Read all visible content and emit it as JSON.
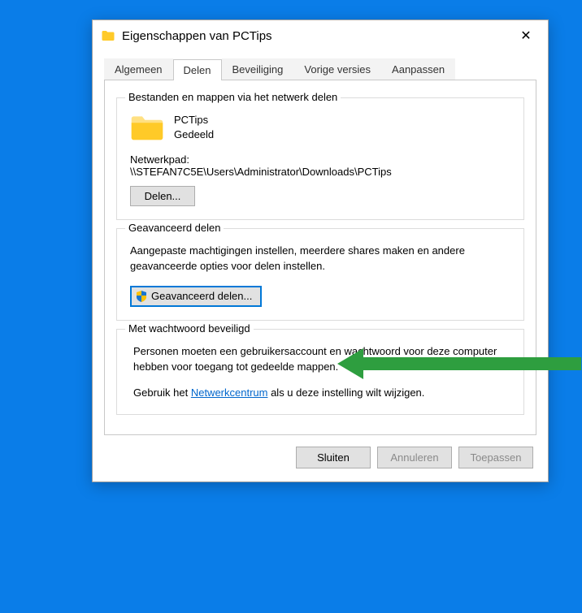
{
  "window": {
    "title": "Eigenschappen van PCTips"
  },
  "tabs": {
    "algemeen": "Algemeen",
    "delen": "Delen",
    "beveiliging": "Beveiliging",
    "vorige_versies": "Vorige versies",
    "aanpassen": "Aanpassen"
  },
  "share_group": {
    "legend": "Bestanden en mappen via het netwerk delen",
    "folder_name": "PCTips",
    "status": "Gedeeld",
    "netpath_label": "Netwerkpad:",
    "netpath_value": "\\\\STEFAN7C5E\\Users\\Administrator\\Downloads\\PCTips",
    "share_button": "Delen..."
  },
  "advanced_group": {
    "legend": "Geavanceerd delen",
    "description": "Aangepaste machtigingen instellen, meerdere shares maken en andere geavanceerde opties voor delen instellen.",
    "button": "Geavanceerd delen..."
  },
  "password_group": {
    "legend": "Met wachtwoord beveiligd",
    "line1": "Personen moeten een gebruikersaccount en wachtwoord voor deze computer hebben voor toegang tot gedeelde mappen.",
    "line2_pre": "Gebruik het ",
    "link": "Netwerkcentrum",
    "line2_post": " als u deze instelling wilt wijzigen."
  },
  "buttons": {
    "close": "Sluiten",
    "cancel": "Annuleren",
    "apply": "Toepassen"
  }
}
